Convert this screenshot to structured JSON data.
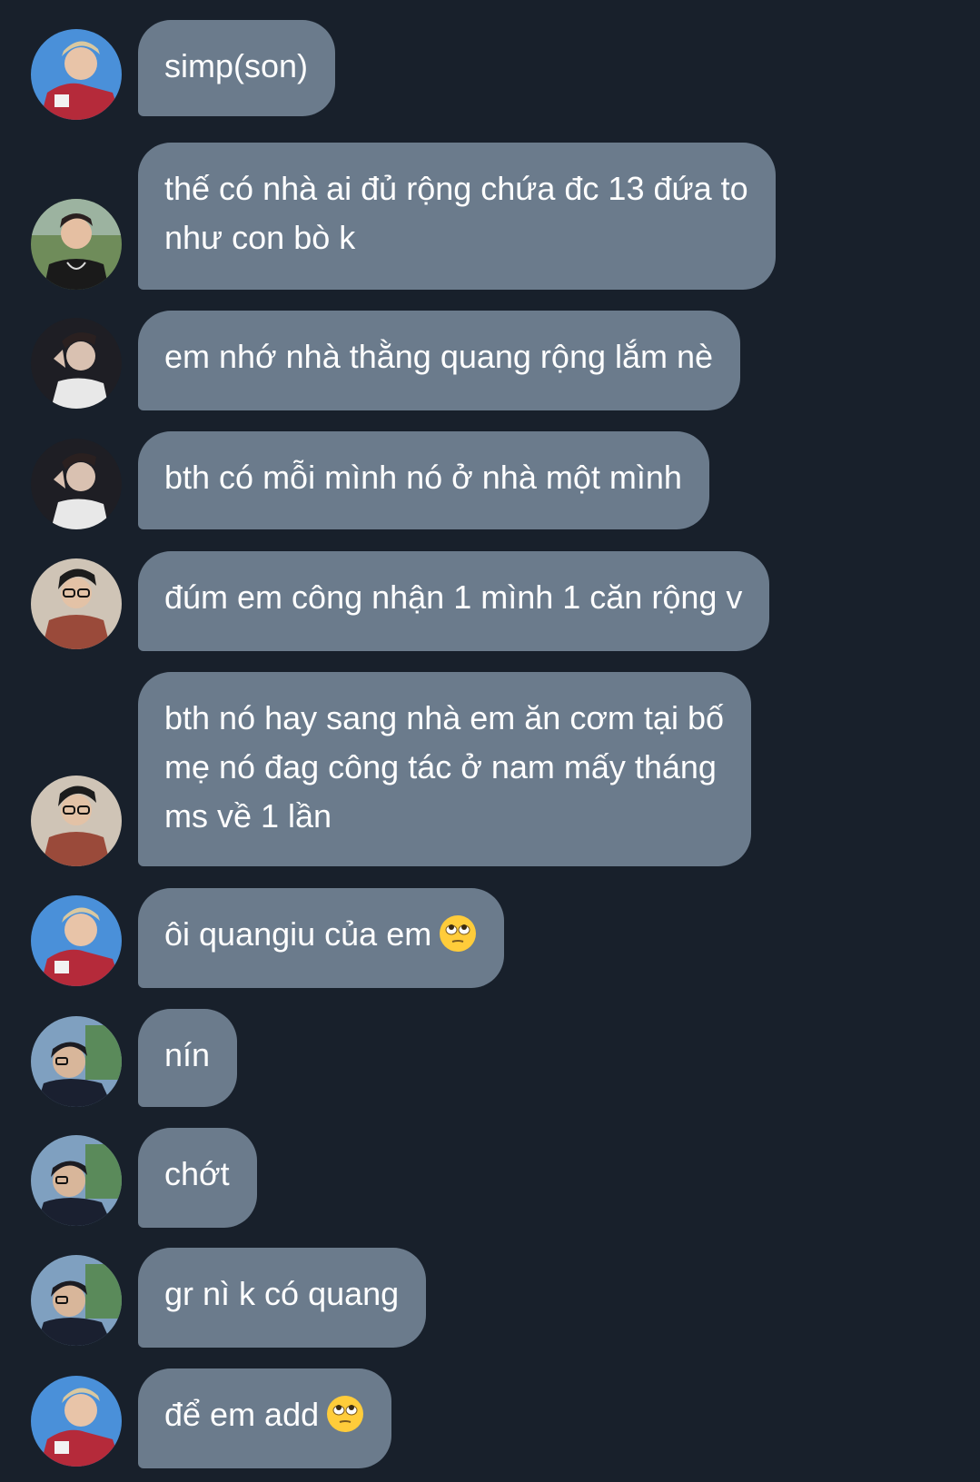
{
  "messages": [
    {
      "sender": "a",
      "text": "simp(son)",
      "emoji": ""
    },
    {
      "sender": "b",
      "lines": [
        "thế có nhà ai đủ rộng chứa đc 13 đứa to",
        "như con bò k"
      ],
      "emoji": ""
    },
    {
      "sender": "c",
      "text": "em nhớ nhà thằng quang rộng lắm nè",
      "emoji": ""
    },
    {
      "sender": "c",
      "text": "bth có mỗi mình nó ở nhà một mình",
      "emoji": ""
    },
    {
      "sender": "d",
      "text": "đúm em công nhận 1 mình 1 căn rộng v",
      "emoji": ""
    },
    {
      "sender": "d",
      "lines": [
        "bth nó hay sang nhà em ăn cơm tại bố",
        "mẹ nó đag công tác ở nam mấy tháng",
        "ms về 1 lần"
      ],
      "emoji": ""
    },
    {
      "sender": "a",
      "text": "ôi quangiu của em",
      "emoji": "face-with-rolling-eyes"
    },
    {
      "sender": "e",
      "text": "nín",
      "emoji": ""
    },
    {
      "sender": "e",
      "text": "chớt",
      "emoji": ""
    },
    {
      "sender": "e",
      "text": "gr nì k có quang",
      "emoji": ""
    },
    {
      "sender": "a",
      "text": "để em add",
      "emoji": "face-with-rolling-eyes"
    }
  ],
  "colors": {
    "background": "#18202b",
    "bubble": "#6b7b8c",
    "text": "#ffffff"
  }
}
